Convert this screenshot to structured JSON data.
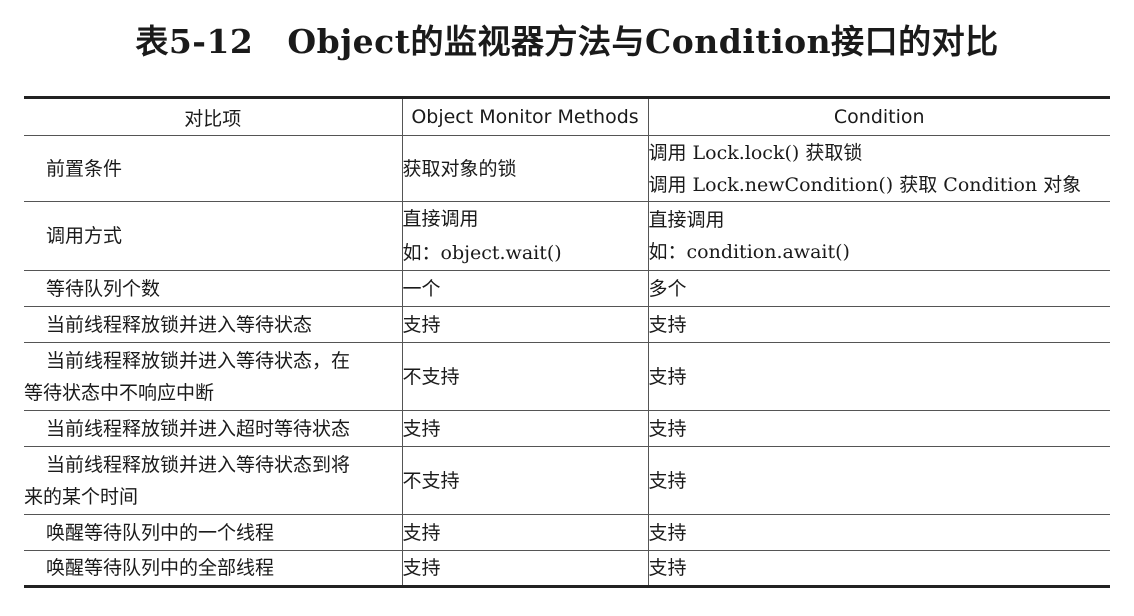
{
  "caption": {
    "number": "表5-12",
    "text": "Object的监视器方法与Condition接口的对比"
  },
  "table": {
    "headers": {
      "feature": "对比项",
      "object_monitor": "Object Monitor Methods",
      "condition": "Condition"
    },
    "rows": [
      {
        "feature": [
          "前置条件"
        ],
        "object_monitor": [
          "获取对象的锁"
        ],
        "condition": [
          "调用 Lock.lock() 获取锁",
          "调用 Lock.newCondition() 获取 Condition 对象"
        ]
      },
      {
        "feature": [
          "调用方式"
        ],
        "object_monitor": [
          "直接调用",
          "如：object.wait()"
        ],
        "condition": [
          "直接调用",
          "如：condition.await()"
        ]
      },
      {
        "feature": [
          "等待队列个数"
        ],
        "object_monitor": [
          "一个"
        ],
        "condition": [
          "多个"
        ]
      },
      {
        "feature": [
          "当前线程释放锁并进入等待状态"
        ],
        "object_monitor": [
          "支持"
        ],
        "condition": [
          "支持"
        ]
      },
      {
        "feature": [
          "当前线程释放锁并进入等待状态，在",
          "等待状态中不响应中断"
        ],
        "object_monitor": [
          "不支持"
        ],
        "condition": [
          "支持"
        ]
      },
      {
        "feature": [
          "当前线程释放锁并进入超时等待状态"
        ],
        "object_monitor": [
          "支持"
        ],
        "condition": [
          "支持"
        ]
      },
      {
        "feature": [
          "当前线程释放锁并进入等待状态到将",
          "来的某个时间"
        ],
        "object_monitor": [
          "不支持"
        ],
        "condition": [
          "支持"
        ]
      },
      {
        "feature": [
          "唤醒等待队列中的一个线程"
        ],
        "object_monitor": [
          "支持"
        ],
        "condition": [
          "支持"
        ]
      },
      {
        "feature": [
          "唤醒等待队列中的全部线程"
        ],
        "object_monitor": [
          "支持"
        ],
        "condition": [
          "支持"
        ]
      }
    ]
  }
}
